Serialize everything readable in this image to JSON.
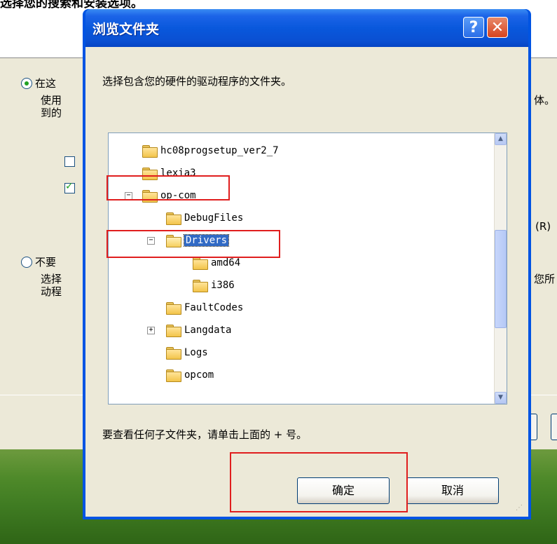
{
  "background": {
    "top_title": "选择您的搜索和安装选项。",
    "radio_search": "在这",
    "search_desc_line1": "使用",
    "search_desc_line2": "到的",
    "desc_cut_right": "体。",
    "browse_cut": "(R)",
    "radio_dont": "不要",
    "dont_desc_line1": "选择",
    "dont_desc_line2": "动程",
    "dont_cut_right": "您所"
  },
  "dialog": {
    "title": "浏览文件夹",
    "help_symbol": "?",
    "close_symbol": "✕",
    "description": "选择包含您的硬件的驱动程序的文件夹。",
    "hint": "要查看任何子文件夹，请单击上面的 + 号。",
    "ok_label": "确定",
    "cancel_label": "取消",
    "tree": [
      {
        "label": "hc08progsetup_ver2_7",
        "level": 0,
        "expander": "",
        "selected": false
      },
      {
        "label": "lexia3",
        "level": 0,
        "expander": "",
        "selected": false
      },
      {
        "label": "op-com",
        "level": 0,
        "expander": "−",
        "selected": false
      },
      {
        "label": "DebugFiles",
        "level": 1,
        "expander": "",
        "selected": false
      },
      {
        "label": "Drivers",
        "level": 1,
        "expander": "−",
        "selected": true
      },
      {
        "label": "amd64",
        "level": 2,
        "expander": "",
        "selected": false
      },
      {
        "label": "i386",
        "level": 2,
        "expander": "",
        "selected": false
      },
      {
        "label": "FaultCodes",
        "level": 1,
        "expander": "",
        "selected": false
      },
      {
        "label": "Langdata",
        "level": 1,
        "expander": "+",
        "selected": false
      },
      {
        "label": "Logs",
        "level": 1,
        "expander": "",
        "selected": false
      },
      {
        "label": "opcom",
        "level": 1,
        "expander": "",
        "selected": false
      }
    ]
  },
  "colors": {
    "titlebar": "#0a58dc",
    "annotation": "#e01e1e",
    "selection": "#316ac5"
  }
}
